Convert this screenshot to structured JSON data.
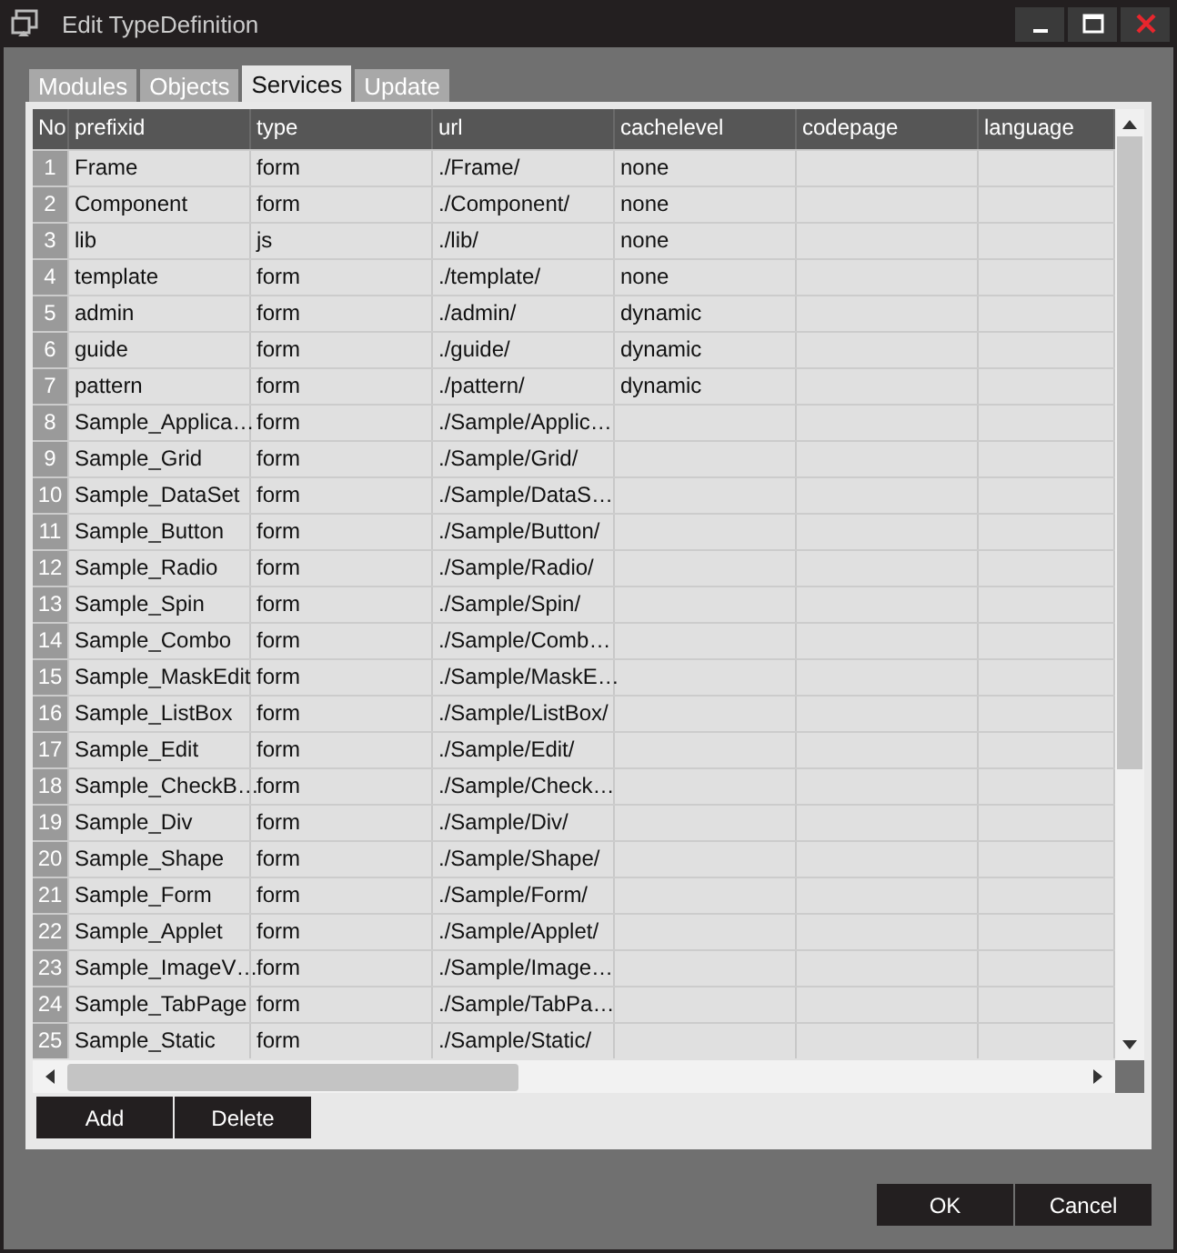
{
  "window": {
    "title": "Edit TypeDefinition"
  },
  "tabs": [
    {
      "label": "Modules",
      "selected": false
    },
    {
      "label": "Objects",
      "selected": false
    },
    {
      "label": "Services",
      "selected": true
    },
    {
      "label": "Update",
      "selected": false
    }
  ],
  "table": {
    "columns": [
      "No",
      "prefixid",
      "type",
      "url",
      "cachelevel",
      "codepage",
      "language"
    ],
    "rows": [
      [
        "1",
        "Frame",
        "form",
        "./Frame/",
        "none",
        "",
        ""
      ],
      [
        "2",
        "Component",
        "form",
        "./Component/",
        "none",
        "",
        ""
      ],
      [
        "3",
        "lib",
        "js",
        "./lib/",
        "none",
        "",
        ""
      ],
      [
        "4",
        "template",
        "form",
        "./template/",
        "none",
        "",
        ""
      ],
      [
        "5",
        "admin",
        "form",
        "./admin/",
        "dynamic",
        "",
        ""
      ],
      [
        "6",
        "guide",
        "form",
        "./guide/",
        "dynamic",
        "",
        ""
      ],
      [
        "7",
        "pattern",
        "form",
        "./pattern/",
        "dynamic",
        "",
        ""
      ],
      [
        "8",
        "Sample_Applica…",
        "form",
        "./Sample/Applic…",
        "",
        "",
        ""
      ],
      [
        "9",
        "Sample_Grid",
        "form",
        "./Sample/Grid/",
        "",
        "",
        ""
      ],
      [
        "10",
        "Sample_DataSet",
        "form",
        "./Sample/DataS…",
        "",
        "",
        ""
      ],
      [
        "11",
        "Sample_Button",
        "form",
        "./Sample/Button/",
        "",
        "",
        ""
      ],
      [
        "12",
        "Sample_Radio",
        "form",
        "./Sample/Radio/",
        "",
        "",
        ""
      ],
      [
        "13",
        "Sample_Spin",
        "form",
        "./Sample/Spin/",
        "",
        "",
        ""
      ],
      [
        "14",
        "Sample_Combo",
        "form",
        "./Sample/Comb…",
        "",
        "",
        ""
      ],
      [
        "15",
        "Sample_MaskEdit",
        "form",
        "./Sample/MaskE…",
        "",
        "",
        ""
      ],
      [
        "16",
        "Sample_ListBox",
        "form",
        "./Sample/ListBox/",
        "",
        "",
        ""
      ],
      [
        "17",
        "Sample_Edit",
        "form",
        "./Sample/Edit/",
        "",
        "",
        ""
      ],
      [
        "18",
        "Sample_CheckB…",
        "form",
        "./Sample/Check…",
        "",
        "",
        ""
      ],
      [
        "19",
        "Sample_Div",
        "form",
        "./Sample/Div/",
        "",
        "",
        ""
      ],
      [
        "20",
        "Sample_Shape",
        "form",
        "./Sample/Shape/",
        "",
        "",
        ""
      ],
      [
        "21",
        "Sample_Form",
        "form",
        "./Sample/Form/",
        "",
        "",
        ""
      ],
      [
        "22",
        "Sample_Applet",
        "form",
        "./Sample/Applet/",
        "",
        "",
        ""
      ],
      [
        "23",
        "Sample_ImageV…",
        "form",
        "./Sample/Image…",
        "",
        "",
        ""
      ],
      [
        "24",
        "Sample_TabPage",
        "form",
        "./Sample/TabPa…",
        "",
        "",
        ""
      ],
      [
        "25",
        "Sample_Static",
        "form",
        "./Sample/Static/",
        "",
        "",
        ""
      ]
    ]
  },
  "grid_buttons": [
    "Add",
    "Delete"
  ],
  "dialog_buttons": [
    "OK",
    "Cancel"
  ]
}
